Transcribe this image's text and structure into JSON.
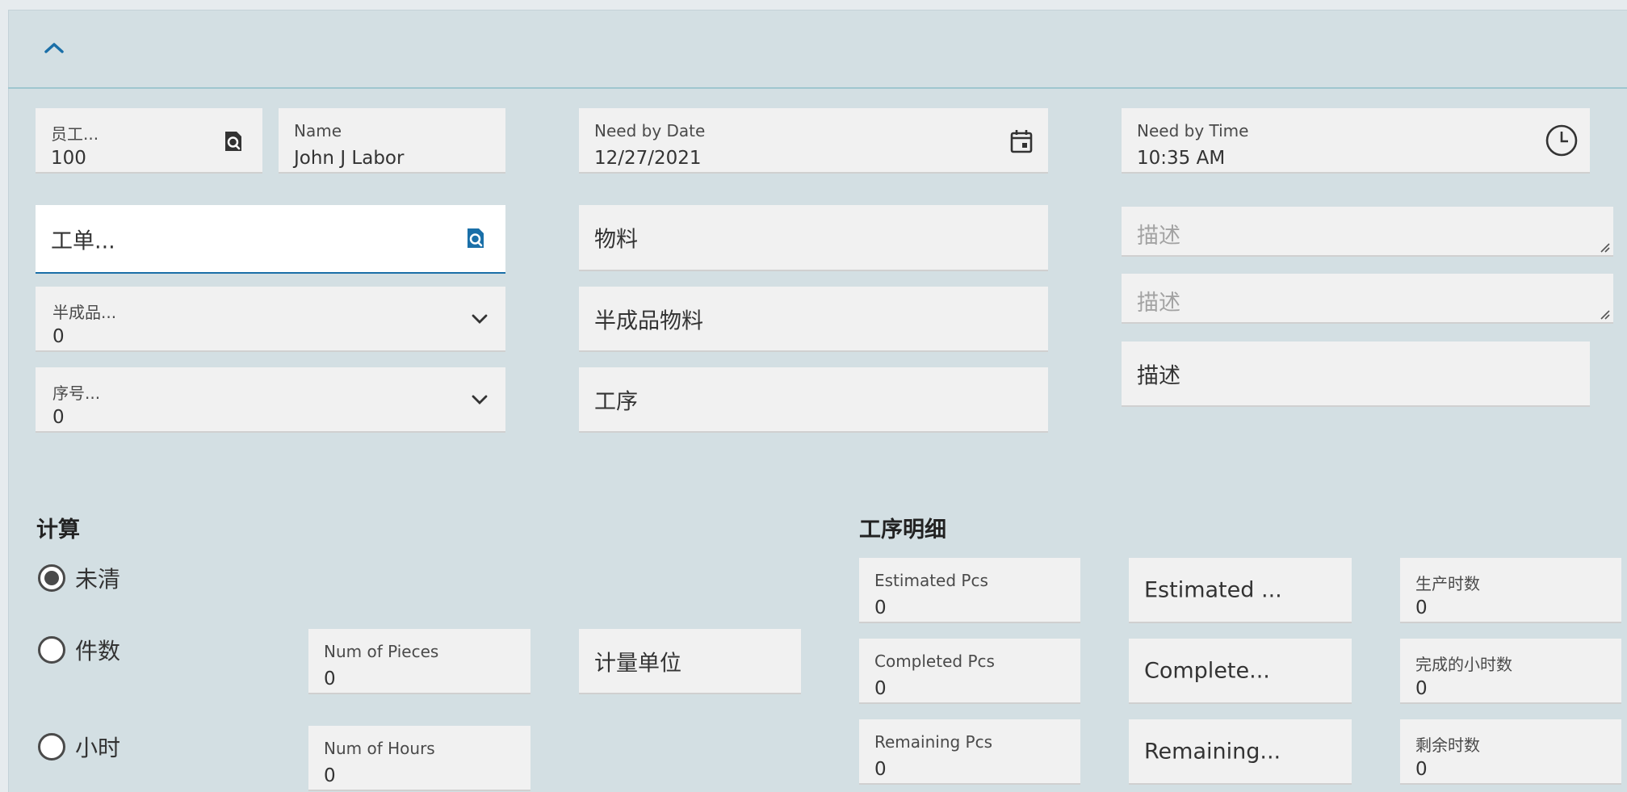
{
  "header": {
    "collapse_icon": "chevron-up-icon"
  },
  "row1": {
    "employee": {
      "label": "员工...",
      "value": "100"
    },
    "name": {
      "label": "Name",
      "value": "John J Labor"
    },
    "need_by_date": {
      "label": "Need by Date",
      "value": "12/27/2021"
    },
    "need_by_time": {
      "label": "Need by Time",
      "value": "10:35 AM"
    }
  },
  "left": {
    "job_placeholder": "工单...",
    "assembly": {
      "label": "半成品...",
      "value": "0"
    },
    "operation": {
      "label": "序号...",
      "value": "0"
    }
  },
  "middle": {
    "part": "物料",
    "assembly_part": "半成品物料",
    "operation_desc": "工序"
  },
  "right": {
    "desc1_placeholder": "描述",
    "desc2_placeholder": "描述",
    "desc3": "描述"
  },
  "calc": {
    "title": "计算",
    "options": [
      {
        "label": "未清",
        "selected": true
      },
      {
        "label": "件数",
        "selected": false
      },
      {
        "label": "小时",
        "selected": false
      }
    ],
    "num_pieces": {
      "label": "Num of Pieces",
      "value": "0"
    },
    "num_hours": {
      "label": "Num of Hours",
      "value": "0"
    },
    "uom": "计量单位"
  },
  "op_details": {
    "title": "工序明细",
    "estimated_pcs": {
      "label": "Estimated Pcs",
      "value": "0"
    },
    "completed_pcs": {
      "label": "Completed Pcs",
      "value": "0"
    },
    "remaining_pcs": {
      "label": "Remaining Pcs",
      "value": "0"
    },
    "estimated_uom": "Estimated ...",
    "completed_uom": "Complete...",
    "remaining_uom": "Remaining...",
    "prod_hours": {
      "label": "生产时数",
      "value": "0"
    },
    "completed_hours": {
      "label": "完成的小时数",
      "value": "0"
    },
    "remaining_hours": {
      "label": "剩余时数",
      "value": "0"
    }
  },
  "colors": {
    "panel_bg": "#d3dfe3",
    "accent": "#1a6fa8",
    "field_bg": "#f1f1f1"
  }
}
